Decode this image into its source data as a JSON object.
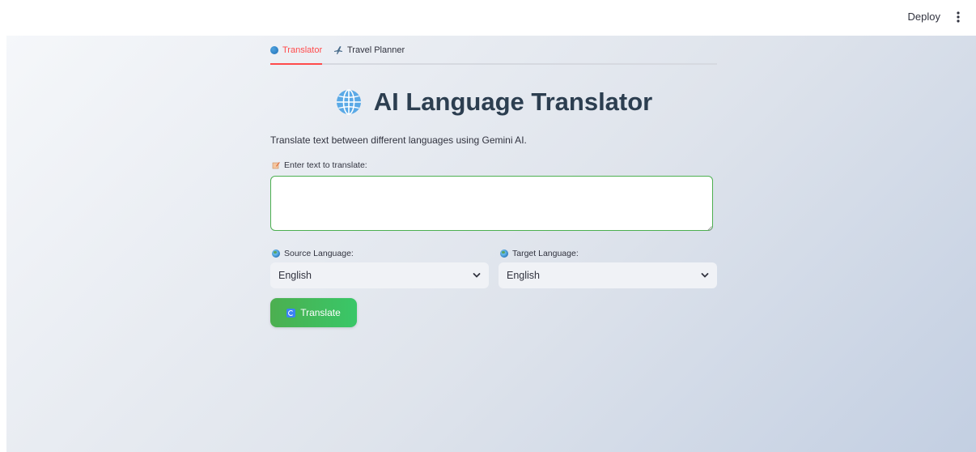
{
  "header": {
    "deploy_label": "Deploy",
    "menu_icon": "kebab-menu-icon"
  },
  "tabs": [
    {
      "label": "Translator",
      "icon": "globe-icon",
      "active": true
    },
    {
      "label": "Travel Planner",
      "icon": "airplane-icon",
      "active": false
    }
  ],
  "page": {
    "title": "AI Language Translator",
    "title_icon": "globe-icon",
    "subtitle": "Translate text between different languages using Gemini AI."
  },
  "text_input": {
    "label": "Enter text to translate:",
    "label_icon": "memo-icon",
    "value": "",
    "placeholder": ""
  },
  "source_language": {
    "label": "Source Language:",
    "label_icon": "earth-icon",
    "selected": "English"
  },
  "target_language": {
    "label": "Target Language:",
    "label_icon": "earth-icon",
    "selected": "English"
  },
  "translate_button": {
    "label": "Translate",
    "icon": "refresh-icon"
  },
  "colors": {
    "accent_red": "#ff4b4b",
    "button_green": "#4caf50",
    "title_color": "#2c3e50",
    "input_border_green": "#4caf50"
  }
}
